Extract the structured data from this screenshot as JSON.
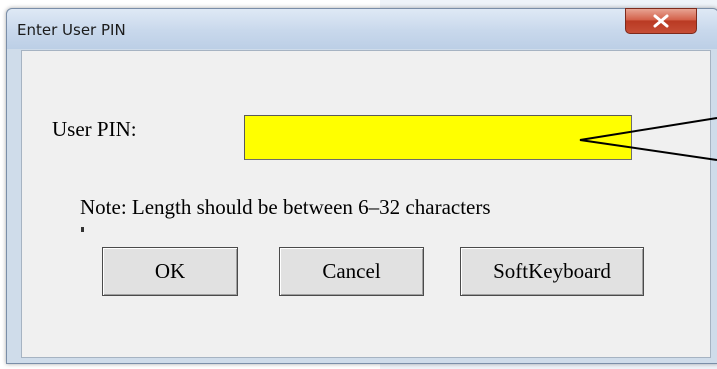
{
  "dialog": {
    "title": "Enter User PIN",
    "close_icon": "close-icon",
    "pin_label": "User PIN:",
    "pin_value": "",
    "note": "Note: Length should be between 6–32 characters",
    "buttons": {
      "ok": "OK",
      "cancel": "Cancel",
      "softkeyboard": "SoftKeyboard"
    }
  },
  "colors": {
    "pin_input_bg": "#ffff00",
    "close_button": "#c64d36",
    "titlebar": "#c8d8ec",
    "client_bg": "#f0f0f0"
  }
}
